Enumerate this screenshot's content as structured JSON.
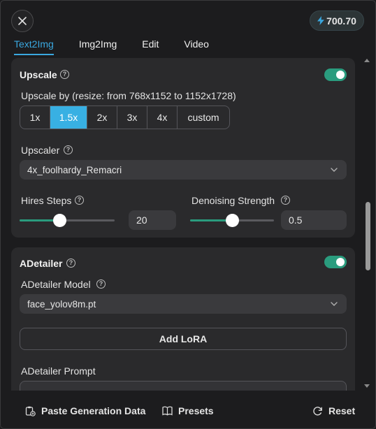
{
  "header": {
    "close_icon": "close-icon",
    "credits": "700.70",
    "credits_icon": "lightning-icon"
  },
  "tabs": [
    {
      "label": "Text2Img",
      "active": true
    },
    {
      "label": "Img2Img",
      "active": false
    },
    {
      "label": "Edit",
      "active": false
    },
    {
      "label": "Video",
      "active": false
    }
  ],
  "upscale": {
    "title": "Upscale",
    "enabled": true,
    "upscale_by_label": "Upscale by (resize: from 768x1152 to 1152x1728)",
    "factors": [
      "1x",
      "1.5x",
      "2x",
      "3x",
      "4x",
      "custom"
    ],
    "selected_factor": "1.5x",
    "upscaler_label": "Upscaler",
    "upscaler_value": "4x_foolhardy_Remacri",
    "hires_steps_label": "Hires Steps",
    "hires_steps_value": "20",
    "hires_steps_fraction": 0.42,
    "denoise_label": "Denoising Strength",
    "denoise_value": "0.5",
    "denoise_fraction": 0.5
  },
  "adetailer": {
    "title": "ADetailer",
    "enabled": true,
    "model_label": "ADetailer Model",
    "model_value": "face_yolov8m.pt",
    "add_lora_label": "Add LoRA",
    "prompt_label": "ADetailer Prompt"
  },
  "footer": {
    "paste_label": "Paste Generation Data",
    "presets_label": "Presets",
    "reset_label": "Reset"
  },
  "colors": {
    "accent_blue": "#38b0e3",
    "toggle_green": "#2a9c7e",
    "background": "#1c1c1e",
    "card": "#2a2a2c"
  }
}
